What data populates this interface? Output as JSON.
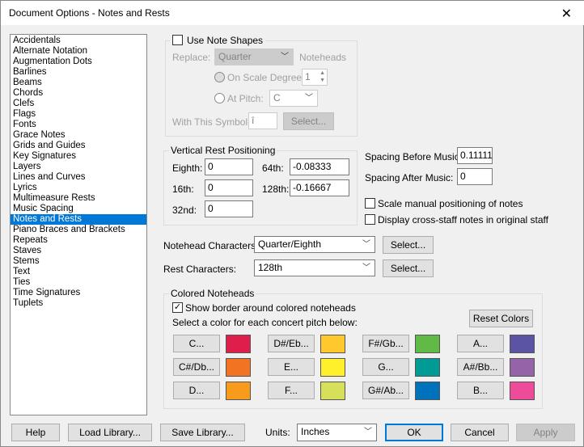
{
  "title": "Document Options - Notes and Rests",
  "sidebar": {
    "items": [
      "Accidentals",
      "Alternate Notation",
      "Augmentation Dots",
      "Barlines",
      "Beams",
      "Chords",
      "Clefs",
      "Flags",
      "Fonts",
      "Grace Notes",
      "Grids and Guides",
      "Key Signatures",
      "Layers",
      "Lines and Curves",
      "Lyrics",
      "Multimeasure Rests",
      "Music Spacing",
      "Notes and Rests",
      "Piano Braces and Brackets",
      "Repeats",
      "Staves",
      "Stems",
      "Text",
      "Ties",
      "Time Signatures",
      "Tuplets"
    ],
    "selected": "Notes and Rests"
  },
  "note_shapes": {
    "use_label": "Use Note Shapes",
    "replace_label": "Replace:",
    "replace_value": "Quarter",
    "noteheads_label": "Noteheads",
    "scale_degree_label": "On Scale Degree:",
    "scale_degree_value": "1",
    "at_pitch_label": "At Pitch:",
    "at_pitch_value": "C",
    "symbol_label": "With This Symbol:",
    "symbol_value": "î",
    "select_label": "Select..."
  },
  "vertical_rest": {
    "title": "Vertical Rest Positioning",
    "eighth_label": "Eighth:",
    "eighth": "0",
    "sixteenth_label": "16th:",
    "sixteenth": "0",
    "thirtysecond_label": "32nd:",
    "thirtysecond": "0",
    "sixtyfourth_label": "64th:",
    "sixtyfourth": "-0.08333",
    "onetwentyeighth_label": "128th:",
    "onetwentyeighth": "-0.16667"
  },
  "spacing": {
    "before_label": "Spacing Before Music:",
    "before": "0.11111",
    "after_label": "Spacing After Music:",
    "after": "0",
    "scale_manual": "Scale manual positioning of notes",
    "cross_staff": "Display cross-staff notes in original staff"
  },
  "characters": {
    "notehead_label": "Notehead Characters:",
    "notehead_value": "Quarter/Eighth",
    "rest_label": "Rest Characters:",
    "rest_value": "128th",
    "select_label": "Select..."
  },
  "colored": {
    "title": "Colored Noteheads",
    "show_border": "Show border around colored noteheads",
    "instruction": "Select a color for each concert pitch below:",
    "reset": "Reset Colors",
    "pitches": [
      {
        "label": "C...",
        "color": "#E01E4B"
      },
      {
        "label": "C#/Db...",
        "color": "#F27321"
      },
      {
        "label": "D...",
        "color": "#F89B1C"
      },
      {
        "label": "D#/Eb...",
        "color": "#FFC92E"
      },
      {
        "label": "E...",
        "color": "#FFF02B"
      },
      {
        "label": "F...",
        "color": "#D6E05A"
      },
      {
        "label": "F#/Gb...",
        "color": "#62BA46"
      },
      {
        "label": "G...",
        "color": "#009B94"
      },
      {
        "label": "G#/Ab...",
        "color": "#0072BC"
      },
      {
        "label": "A...",
        "color": "#5B53A3"
      },
      {
        "label": "A#/Bb...",
        "color": "#9563A8"
      },
      {
        "label": "B...",
        "color": "#EE4C9B"
      }
    ]
  },
  "footer": {
    "help": "Help",
    "load": "Load Library...",
    "save": "Save Library...",
    "units_label": "Units:",
    "units": "Inches",
    "ok": "OK",
    "cancel": "Cancel",
    "apply": "Apply"
  }
}
